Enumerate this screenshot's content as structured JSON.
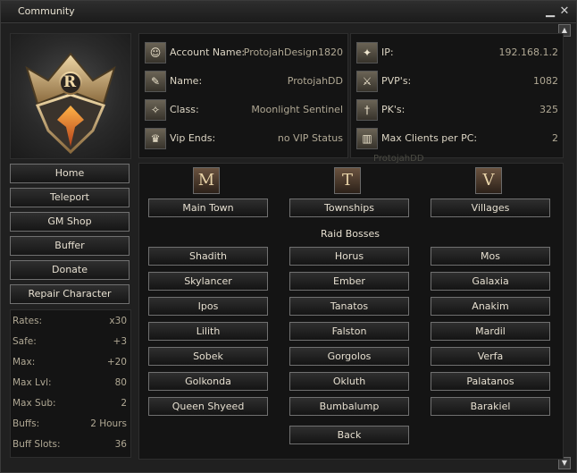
{
  "window": {
    "title": "Community",
    "minimize_glyph": "▁",
    "close_glyph": "✕",
    "scroll_up_glyph": "▲",
    "scroll_down_glyph": "▼"
  },
  "logo": {
    "letter": "R",
    "icon": "crest-emblem"
  },
  "nav": [
    {
      "label": "Home"
    },
    {
      "label": "Teleport"
    },
    {
      "label": "GM Shop"
    },
    {
      "label": "Buffer"
    },
    {
      "label": "Donate"
    },
    {
      "label": "Repair Character"
    }
  ],
  "stats": [
    {
      "label": "Rates:",
      "value": "x30"
    },
    {
      "label": "Safe:",
      "value": "+3"
    },
    {
      "label": "Max:",
      "value": "+20"
    },
    {
      "label": "Max Lvl:",
      "value": "80"
    },
    {
      "label": "Max Sub:",
      "value": "2"
    },
    {
      "label": "Buffs:",
      "value": "2 Hours"
    },
    {
      "label": "Buff Slots:",
      "value": "36"
    }
  ],
  "account_info": [
    {
      "label": "Account Name:",
      "value": "ProtojahDesign1820",
      "icon": "account-icon",
      "glyph": "☺"
    },
    {
      "label": "Name:",
      "value": "ProtojahDD",
      "icon": "name-icon",
      "glyph": "✎"
    },
    {
      "label": "Class:",
      "value": "Moonlight Sentinel",
      "icon": "class-icon",
      "glyph": "✧"
    },
    {
      "label": "Vip Ends:",
      "value": "no VIP Status",
      "icon": "vip-icon",
      "glyph": "♛"
    }
  ],
  "server_info": [
    {
      "label": "IP:",
      "value": "192.168.1.2",
      "icon": "ip-icon",
      "glyph": "✦"
    },
    {
      "label": "PVP's:",
      "value": "1082",
      "icon": "pvp-icon",
      "glyph": "⚔"
    },
    {
      "label": "PK's:",
      "value": "325",
      "icon": "pk-icon",
      "glyph": "†"
    },
    {
      "label": "Max Clients per PC:",
      "value": "2",
      "icon": "clients-icon",
      "glyph": "▥"
    }
  ],
  "watermark": "ProtojahDD",
  "teleport_categories": [
    {
      "letter": "M",
      "label": "Main Town"
    },
    {
      "letter": "T",
      "label": "Townships"
    },
    {
      "letter": "V",
      "label": "Villages"
    }
  ],
  "raid_bosses": {
    "title": "Raid Bosses",
    "col1": [
      "Shadith",
      "Skylancer",
      "Ipos",
      "Lilith",
      "Sobek",
      "Golkonda",
      "Queen Shyeed"
    ],
    "col2": [
      "Horus",
      "Ember",
      "Tanatos",
      "Falston",
      "Gorgolos",
      "Okluth",
      "Bumbalump"
    ],
    "col3": [
      "Mos",
      "Galaxia",
      "Anakim",
      "Mardil",
      "Verfa",
      "Palatanos",
      "Barakiel"
    ]
  },
  "back_label": "Back"
}
